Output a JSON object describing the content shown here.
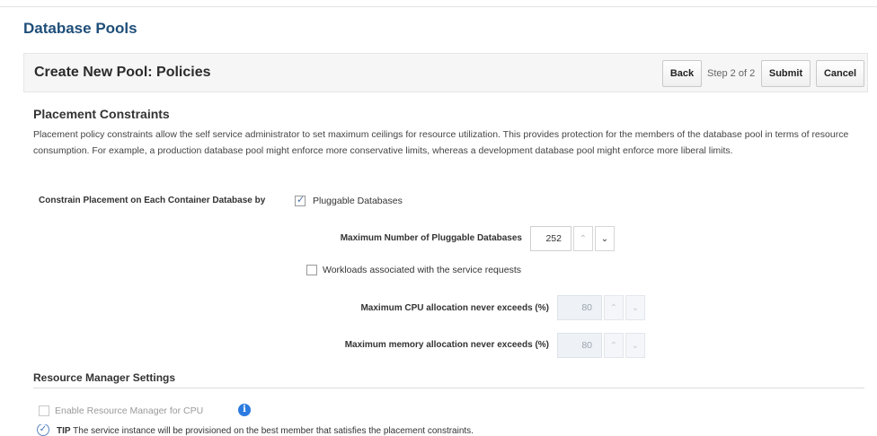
{
  "page": {
    "title": "Database Pools"
  },
  "header": {
    "title": "Create New Pool: Policies",
    "back_label": "Back",
    "step_text": "Step 2 of 2",
    "submit_label": "Submit",
    "cancel_label": "Cancel"
  },
  "placement": {
    "title": "Placement Constraints",
    "description": "Placement policy constraints allow the self service administrator to set maximum ceilings for resource utilization. This provides protection for the members of the database pool in terms of resource consumption. For example, a production database pool might enforce more conservative limits, whereas a development database pool might enforce more liberal limits.",
    "constrain_label": "Constrain Placement on Each Container Database by",
    "pluggable_label": "Pluggable Databases",
    "pluggable_checked": true,
    "max_pdb_label": "Maximum Number of Pluggable Databases",
    "max_pdb_value": "252",
    "workloads_label": "Workloads associated with the service requests",
    "workloads_checked": false,
    "cpu_label": "Maximum CPU allocation never exceeds (%)",
    "cpu_value": "80",
    "memory_label": "Maximum memory allocation never exceeds (%)",
    "memory_value": "80"
  },
  "resource_manager": {
    "title": "Resource Manager Settings",
    "enable_cpu_label": "Enable Resource Manager for CPU",
    "enable_cpu_checked": false,
    "info_icon": "i"
  },
  "tip": {
    "label": "TIP",
    "text": "The service instance will be provisioned on the best member that satisfies the placement constraints."
  },
  "icons": {
    "spin_up": "^",
    "spin_down": "v",
    "info": "info-icon",
    "tip": "check-circle-icon"
  }
}
